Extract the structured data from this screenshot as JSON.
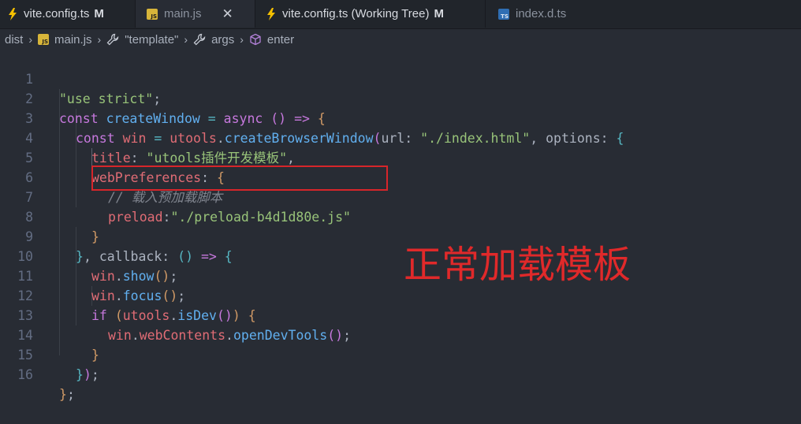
{
  "tabs": [
    {
      "label": "vite.config.ts",
      "badge": "M",
      "icon": "bolt-icon"
    },
    {
      "label": "main.js",
      "close": "✕",
      "icon": "js-file-icon"
    },
    {
      "label": "vite.config.ts (Working Tree)",
      "badge": "M",
      "icon": "bolt-icon"
    },
    {
      "label": "index.d.ts",
      "icon": "ts-file-icon",
      "icon_text": "TS"
    }
  ],
  "js_icon_text": "JS",
  "breadcrumb": [
    "dist",
    "main.js",
    "\"template\"",
    "args",
    "enter"
  ],
  "line_numbers": [
    "1",
    "2",
    "3",
    "4",
    "5",
    "6",
    "7",
    "8",
    "9",
    "10",
    "11",
    "12",
    "13",
    "14",
    "15",
    "16"
  ],
  "code": {
    "l1": "\"use strict\"",
    "l1_end": ";",
    "const": "const",
    "createWindow": "createWindow",
    "eq": "=",
    "async": "async",
    "arrow": "=>",
    "win": "win",
    "utools": "utools",
    "createBrowserWindow": "createBrowserWindow",
    "hint_url": "url:",
    "index_html": "\"./index.html\"",
    "hint_options": "options:",
    "title_key": "title",
    "title_val": "\"utools插件开发模板\"",
    "webPreferences": "webPreferences",
    "comment": "// 载入预加载脚本",
    "preload_key": "preload",
    "preload_val": "\"./preload-b4d1d80e.js\"",
    "hint_callback": "callback:",
    "show": "show",
    "focus": "focus",
    "if": "if",
    "isDev": "isDev",
    "webContents": "webContents",
    "openDevTools": "openDevTools"
  },
  "overlay_text": "正常加载模板",
  "colors": {
    "background": "#282c34",
    "annotation": "#e0292a"
  }
}
